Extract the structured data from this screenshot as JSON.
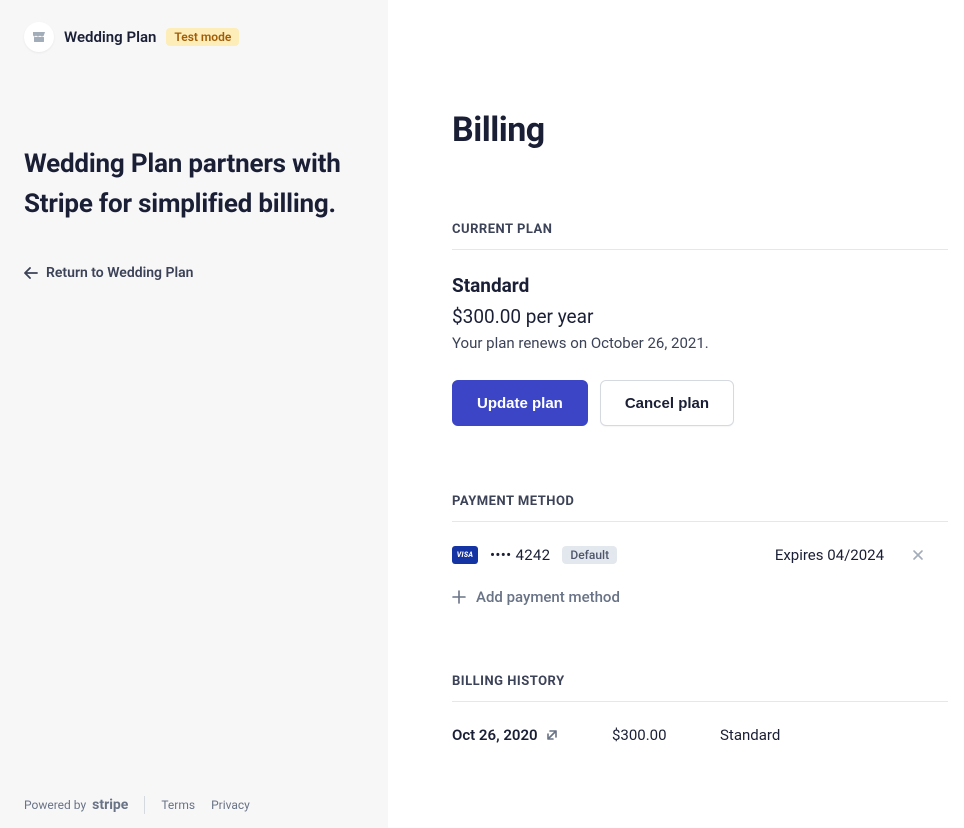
{
  "brand": {
    "name": "Wedding Plan",
    "test_mode_label": "Test mode"
  },
  "sidebar": {
    "tagline": "Wedding Plan partners with Stripe for simplified billing.",
    "return_label": "Return to Wedding Plan"
  },
  "footer": {
    "powered_by": "Powered by",
    "stripe_label": "stripe",
    "terms": "Terms",
    "privacy": "Privacy"
  },
  "page": {
    "title": "Billing"
  },
  "current_plan": {
    "section_label": "CURRENT PLAN",
    "name": "Standard",
    "price": "$300.00 per year",
    "renewal": "Your plan renews on October 26, 2021.",
    "update_label": "Update plan",
    "cancel_label": "Cancel plan"
  },
  "payment_method": {
    "section_label": "PAYMENT METHOD",
    "card_brand": "VISA",
    "card_last4": "•••• 4242",
    "default_label": "Default",
    "expires": "Expires 04/2024",
    "add_label": "Add payment method"
  },
  "billing_history": {
    "section_label": "BILLING HISTORY",
    "rows": [
      {
        "date": "Oct 26, 2020",
        "amount": "$300.00",
        "plan": "Standard"
      }
    ]
  }
}
